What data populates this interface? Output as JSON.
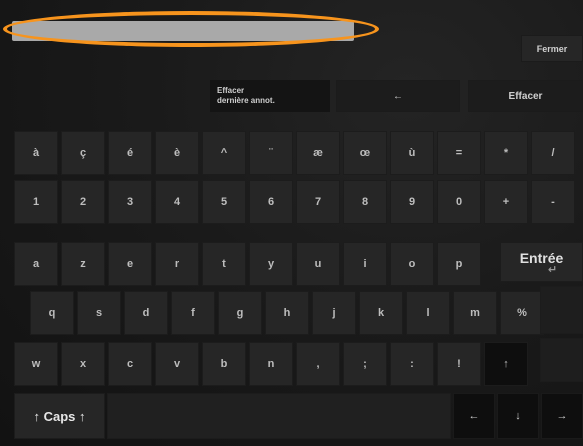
{
  "header": {
    "close_label": "Fermer"
  },
  "toolbar": {
    "clear_annotation_line1": "Effacer",
    "clear_annotation_line2": "dernière annot.",
    "backspace_label": "←",
    "clear_label": "Effacer"
  },
  "keyboard": {
    "row_accents": [
      "à",
      "ç",
      "é",
      "è",
      "^",
      "¨",
      "æ",
      "œ",
      "ù",
      "=",
      "*",
      "/"
    ],
    "row_numbers": [
      "1",
      "2",
      "3",
      "4",
      "5",
      "6",
      "7",
      "8",
      "9",
      "0",
      "+",
      "-"
    ],
    "row_top": [
      "a",
      "z",
      "e",
      "r",
      "t",
      "y",
      "u",
      "i",
      "o",
      "p"
    ],
    "row_home": [
      "q",
      "s",
      "d",
      "f",
      "g",
      "h",
      "j",
      "k",
      "l",
      "m",
      "%"
    ],
    "row_bottom": [
      "w",
      "x",
      "c",
      "v",
      "b",
      "n",
      ",",
      ";",
      ":",
      "!",
      "↑"
    ],
    "enter_label": "Entrée",
    "enter_symbol": "↵",
    "caps_label": "↑ Caps ↑",
    "arrows": [
      "←",
      "↓",
      "→"
    ]
  },
  "colors": {
    "highlight_ring": "#f7941d",
    "text_field": "#a9a9a9",
    "key_background": "#262626"
  }
}
